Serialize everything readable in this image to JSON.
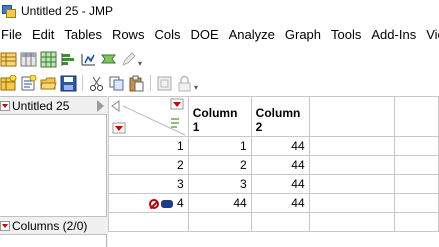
{
  "window": {
    "title": "Untitled 25 - JMP"
  },
  "menu": [
    "File",
    "Edit",
    "Tables",
    "Rows",
    "Cols",
    "DOE",
    "Analyze",
    "Graph",
    "Tools",
    "Add-Ins",
    "View"
  ],
  "toolbar1": [
    {
      "icon": "data-table-icon"
    },
    {
      "icon": "summary-table-icon"
    },
    {
      "icon": "grid-icon"
    },
    {
      "icon": "bar-chart-icon"
    },
    {
      "icon": "distribution-icon"
    },
    {
      "icon": "fit-model-icon"
    },
    {
      "icon": "pencil-icon"
    }
  ],
  "toolbar2": [
    {
      "icon": "new-table-icon"
    },
    {
      "icon": "new-script-icon"
    },
    {
      "icon": "open-folder-icon"
    },
    {
      "icon": "save-icon"
    },
    {
      "icon": "cut-icon"
    },
    {
      "icon": "copy-icon"
    },
    {
      "icon": "paste-icon"
    },
    {
      "icon": "journal-icon"
    },
    {
      "icon": "lock-icon"
    }
  ],
  "table_panel": {
    "name": "Untitled 25"
  },
  "columns_panel": {
    "label": "Columns (2/0)"
  },
  "grid": {
    "columns": [
      "Column 1",
      "Column 2"
    ],
    "rows": [
      {
        "num": "1",
        "c1": "1",
        "c2": "44"
      },
      {
        "num": "2",
        "c1": "2",
        "c2": "44"
      },
      {
        "num": "3",
        "c1": "3",
        "c2": "44"
      },
      {
        "num": "4",
        "c1": "44",
        "c2": "44"
      }
    ]
  },
  "colors": {
    "accent_red": "#d40000",
    "flag_blue": "#1e3a8a"
  }
}
